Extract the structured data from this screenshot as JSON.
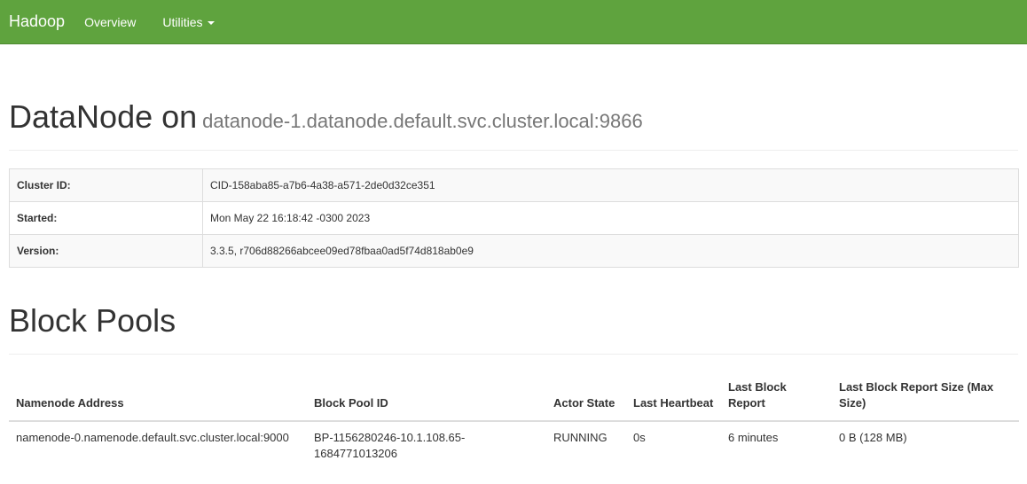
{
  "navbar": {
    "brand": "Hadoop",
    "overview": "Overview",
    "utilities": "Utilities",
    "bg_color": "#5fa33e"
  },
  "header": {
    "title": "DataNode on",
    "host": "datanode-1.datanode.default.svc.cluster.local:9866"
  },
  "info": [
    {
      "key": "Cluster ID:",
      "value": "CID-158aba85-a7b6-4a38-a571-2de0d32ce351"
    },
    {
      "key": "Started:",
      "value": "Mon May 22 16:18:42 -0300 2023"
    },
    {
      "key": "Version:",
      "value": "3.3.5, r706d88266abcee09ed78fbaa0ad5f74d818ab0e9"
    }
  ],
  "block_pools": {
    "title": "Block Pools",
    "columns": [
      "Namenode Address",
      "Block Pool ID",
      "Actor State",
      "Last Heartbeat",
      "Last Block Report",
      "Last Block Report Size (Max Size)"
    ],
    "rows": [
      {
        "namenode_address": "namenode-0.namenode.default.svc.cluster.local:9000",
        "block_pool_id": "BP-1156280246-10.1.108.65-1684771013206",
        "actor_state": "RUNNING",
        "last_heartbeat": "0s",
        "last_block_report": "6 minutes",
        "last_block_report_size": "0 B (128 MB)"
      }
    ]
  }
}
